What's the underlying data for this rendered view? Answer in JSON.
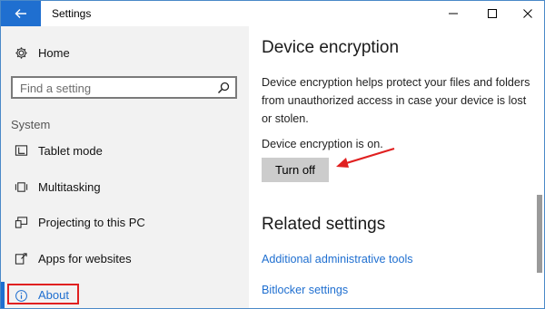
{
  "app": {
    "title": "Settings",
    "back_icon": "back-arrow-icon",
    "controls": [
      "minimize-icon",
      "maximize-icon",
      "close-icon"
    ]
  },
  "sidebar": {
    "home": {
      "label": "Home",
      "icon": "gear-icon"
    },
    "search": {
      "placeholder": "Find a setting",
      "icon": "search-icon"
    },
    "section_header": "System",
    "items": [
      {
        "label": "Tablet mode",
        "icon": "tablet-mode-icon"
      },
      {
        "label": "Multitasking",
        "icon": "multitasking-icon"
      },
      {
        "label": "Projecting to this PC",
        "icon": "projecting-icon"
      },
      {
        "label": "Apps for websites",
        "icon": "apps-for-websites-icon"
      },
      {
        "label": "About",
        "icon": "info-icon",
        "selected": true
      }
    ]
  },
  "main": {
    "title": "Device encryption",
    "description": "Device encryption helps protect your files and folders from unauthorized access in case your device is lost or stolen.",
    "status": "Device encryption is on.",
    "turn_off_button": "Turn off",
    "related_title": "Related settings",
    "links": [
      "Additional administrative tools",
      "Bitlocker settings"
    ]
  },
  "colors": {
    "accent": "#1f6fd0",
    "sidebar_bg": "#f2f2f2",
    "button_bg": "#cccccc",
    "annotation": "#e02020"
  }
}
